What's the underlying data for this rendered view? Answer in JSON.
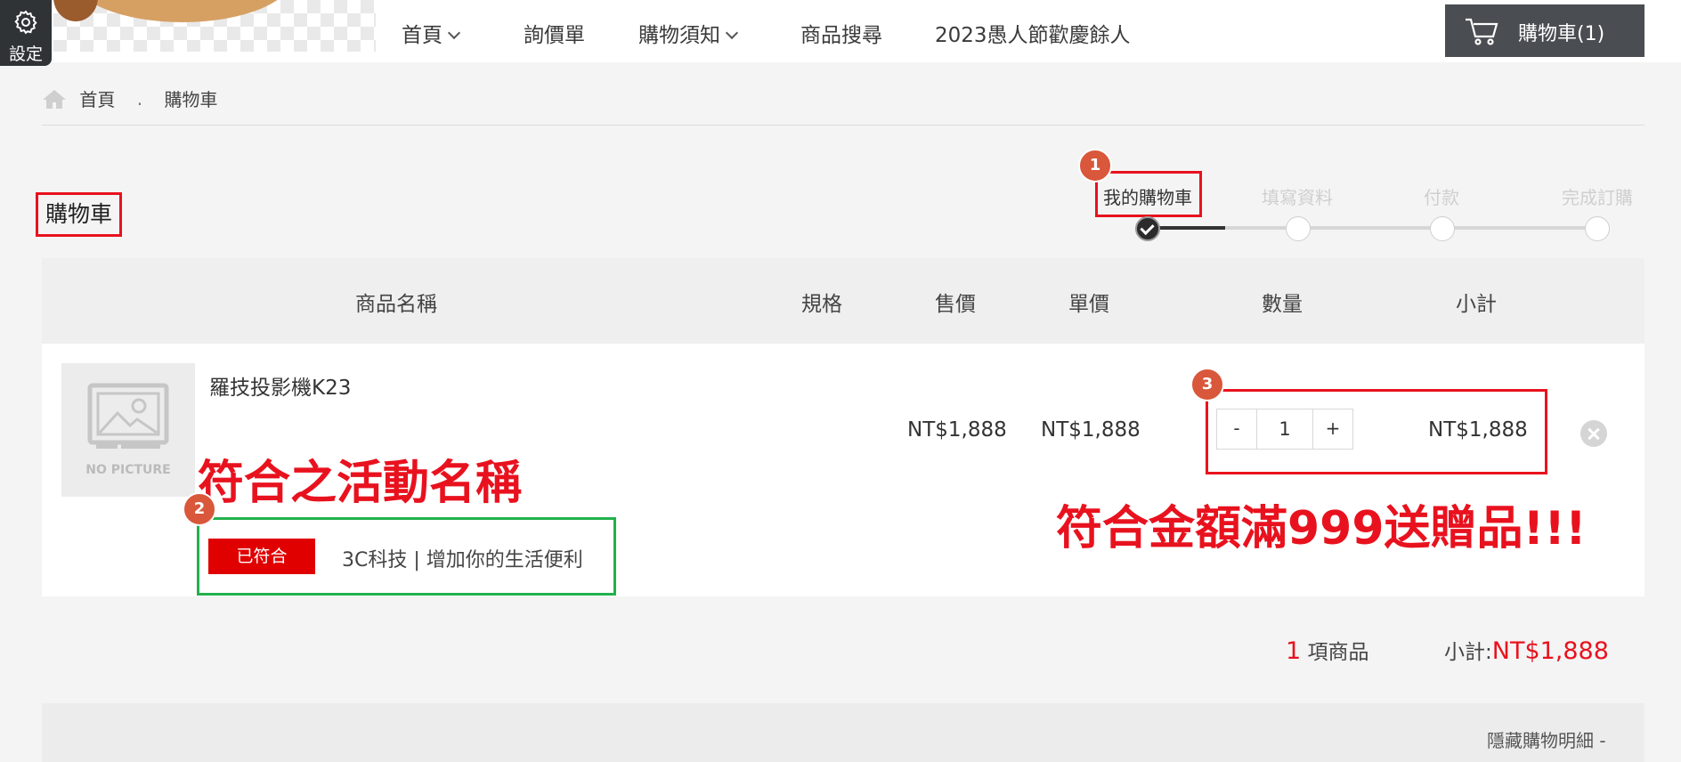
{
  "settings": {
    "label": "設定",
    "icon": "gear-icon"
  },
  "nav": {
    "items": [
      {
        "label": "首頁",
        "has_dropdown": true
      },
      {
        "label": "詢價單",
        "has_dropdown": false
      },
      {
        "label": "購物須知",
        "has_dropdown": true
      },
      {
        "label": "商品搜尋",
        "has_dropdown": false
      },
      {
        "label": "2023愚人節歡慶餘人",
        "has_dropdown": false
      }
    ],
    "cart_label": "購物車(1)"
  },
  "breadcrumb": {
    "home": "首頁",
    "separator": ".",
    "current": "購物車"
  },
  "page_title": "購物車",
  "steps": {
    "items": [
      "我的購物車",
      "填寫資料",
      "付款",
      "完成訂購"
    ],
    "current_index": 0
  },
  "annotations": {
    "badge1": "1",
    "badge2": "2",
    "badge3": "3",
    "activity_name": "符合之活動名稱",
    "gift_note": "符合金額滿999送贈品!!!"
  },
  "table": {
    "headers": [
      "商品名稱",
      "規格",
      "售價",
      "單價",
      "數量",
      "小計"
    ],
    "rows": [
      {
        "thumbnail_text": "NO PICTURE",
        "name": "羅技投影機K23",
        "spec": "",
        "price": "NT$1,888",
        "unit_price": "NT$1,888",
        "quantity": "1",
        "minus": "-",
        "plus": "+",
        "subtotal": "NT$1,888",
        "promo_tag": "已符合",
        "promo_text": "3C科技 | 增加你的生活便利"
      }
    ]
  },
  "summary": {
    "count": "1",
    "count_suffix": "項商品",
    "subtotal_label": "小計:",
    "subtotal_value": "NT$1,888"
  },
  "detail_toggle": "隱藏購物明細 -",
  "colors": {
    "accent_red": "#e8121e",
    "green": "#22b14c",
    "badge": "#d9573a",
    "dark": "#4a4d51"
  }
}
